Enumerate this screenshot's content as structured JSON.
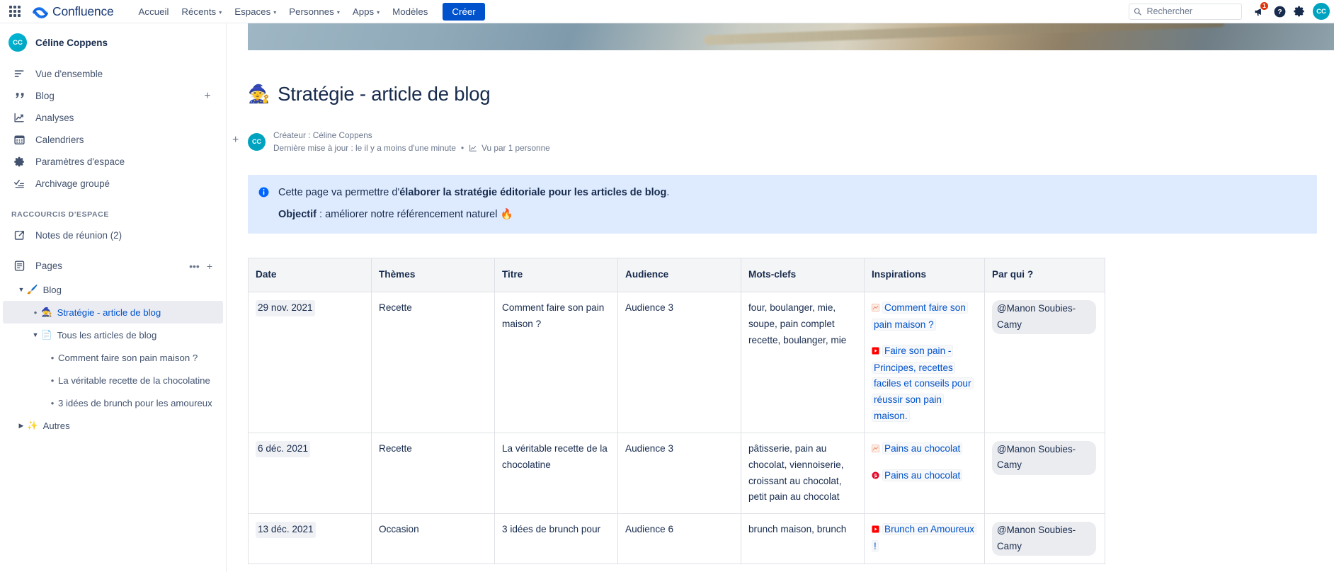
{
  "topnav": {
    "app_switcher": "app-switcher",
    "brand": "Confluence",
    "links": [
      {
        "label": "Accueil",
        "has_caret": false
      },
      {
        "label": "Récents",
        "has_caret": true
      },
      {
        "label": "Espaces",
        "has_caret": true
      },
      {
        "label": "Personnes",
        "has_caret": true
      },
      {
        "label": "Apps",
        "has_caret": true
      },
      {
        "label": "Modèles",
        "has_caret": false
      }
    ],
    "create_label": "Créer",
    "search_placeholder": "Rechercher",
    "search_value": "",
    "notification_count": "1",
    "avatar_initials": "CC"
  },
  "sidebar": {
    "space_name": "Céline Coppens",
    "space_initials": "CC",
    "nav_items": [
      {
        "label": "Vue d'ensemble",
        "icon": "overview-icon",
        "plus": false
      },
      {
        "label": "Blog",
        "icon": "quote-icon",
        "plus": true
      },
      {
        "label": "Analyses",
        "icon": "analytics-icon",
        "plus": false
      },
      {
        "label": "Calendriers",
        "icon": "calendar-icon",
        "plus": false
      },
      {
        "label": "Paramètres d'espace",
        "icon": "gear-icon",
        "plus": false
      },
      {
        "label": "Archivage groupé",
        "icon": "bulk-archive-icon",
        "plus": false
      }
    ],
    "section_title": "RACCOURCIS D'ESPACE",
    "shortcut": {
      "label": "Notes de réunion (2)",
      "icon": "external-link-icon"
    },
    "pages_label": "Pages",
    "tree": [
      {
        "label": "Blog",
        "emoji": "🖌️",
        "level": 1,
        "chevron": "down",
        "selected": false,
        "link": false
      },
      {
        "label": "Stratégie - article de blog",
        "emoji": "🧙",
        "level": 2,
        "chevron": "bullet",
        "selected": true,
        "link": true
      },
      {
        "label": "Tous les articles de blog",
        "emoji": "📄",
        "level": 2,
        "chevron": "down",
        "selected": false,
        "link": false
      },
      {
        "label": "Comment faire son pain maison ?",
        "emoji": "",
        "level": 3,
        "chevron": "bullet",
        "selected": false,
        "link": false
      },
      {
        "label": "La véritable recette de la chocolatine",
        "emoji": "",
        "level": 3,
        "chevron": "bullet",
        "selected": false,
        "link": false
      },
      {
        "label": "3 idées de brunch pour les amoureux",
        "emoji": "",
        "level": 3,
        "chevron": "bullet",
        "selected": false,
        "link": false
      },
      {
        "label": "Autres",
        "emoji": "✨",
        "level": 1,
        "chevron": "right",
        "selected": false,
        "link": false
      }
    ]
  },
  "page": {
    "emoji": "🧙",
    "title": "Stratégie - article de blog",
    "creator_line": "Créateur : Céline Coppens",
    "updated_line": "Dernière mise à jour : le il y a moins d'une minute",
    "separator": "•",
    "views_label": "Vu par 1 personne",
    "avatar_initials": "CC"
  },
  "info_panel": {
    "line1_prefix": "Cette page va permettre d'",
    "line1_bold": "élaborer la stratégie éditoriale pour les articles de blog",
    "line1_suffix": ".",
    "line2_bold": "Objectif",
    "line2_rest": " : améliorer notre référencement naturel 🔥"
  },
  "table": {
    "headers": [
      "Date",
      "Thèmes",
      "Titre",
      "Audience",
      "Mots-clefs",
      "Inspirations",
      "Par qui ?"
    ],
    "rows": [
      {
        "date": "29 nov. 2021",
        "theme": "Recette",
        "titre": "Comment faire son pain maison ?",
        "audience": "Audience 3",
        "mots": "four, boulanger, mie, soupe, pain complet recette, boulanger, mie",
        "inspirations": [
          {
            "icon": "confluence-page-icon",
            "icon_color": "#f5c2b6",
            "text": "Comment faire son pain maison ?"
          },
          {
            "icon": "youtube-icon",
            "icon_color": "#ff0000",
            "text": "Faire son pain - Principes, recettes faciles et conseils pour réussir son pain maison."
          }
        ],
        "qui": "@Manon Soubies-Camy"
      },
      {
        "date": "6 déc. 2021",
        "theme": "Recette",
        "titre": "La véritable recette de la chocolatine",
        "audience": "Audience 3",
        "mots": "pâtisserie, pain au chocolat, viennoiserie, croissant au chocolat, petit pain au chocolat",
        "inspirations": [
          {
            "icon": "confluence-page-icon",
            "icon_color": "#f5c2b6",
            "text": "Pains au chocolat"
          },
          {
            "icon": "pinterest-icon",
            "icon_color": "#e60023",
            "text": "Pains au chocolat"
          }
        ],
        "qui": "@Manon Soubies-Camy"
      },
      {
        "date": "13 déc. 2021",
        "theme": "Occasion",
        "titre": "3 idées de brunch pour",
        "audience": "Audience 6",
        "mots": "brunch maison, brunch",
        "inspirations": [
          {
            "icon": "youtube-icon",
            "icon_color": "#ff0000",
            "text": "Brunch en Amoureux !"
          }
        ],
        "qui": "@Manon Soubies-Camy"
      }
    ]
  }
}
